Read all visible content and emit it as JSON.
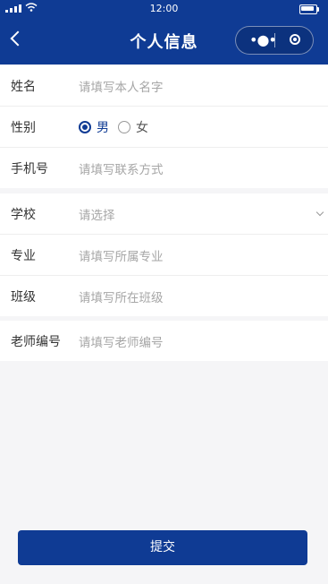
{
  "status_bar": {
    "time": "12:00"
  },
  "nav": {
    "title": "个人信息",
    "more_glyph": "•●•"
  },
  "form": {
    "section1": {
      "name": {
        "label": "姓名",
        "placeholder": "请填写本人名字"
      },
      "gender": {
        "label": "性别",
        "options": [
          {
            "label": "男",
            "checked": true
          },
          {
            "label": "女",
            "checked": false
          }
        ]
      },
      "phone": {
        "label": "手机号",
        "placeholder": "请填写联系方式"
      }
    },
    "section2": {
      "school": {
        "label": "学校",
        "placeholder": "请选择"
      },
      "major": {
        "label": "专业",
        "placeholder": "请填写所属专业"
      },
      "class": {
        "label": "班级",
        "placeholder": "请填写所在班级"
      }
    },
    "section3": {
      "teacher_id": {
        "label": "老师编号",
        "placeholder": "请填写老师编号"
      }
    }
  },
  "submit_label": "提交",
  "colors": {
    "primary": "#0f3b94",
    "background": "#f5f5f7",
    "placeholder": "#a6a6a6"
  }
}
